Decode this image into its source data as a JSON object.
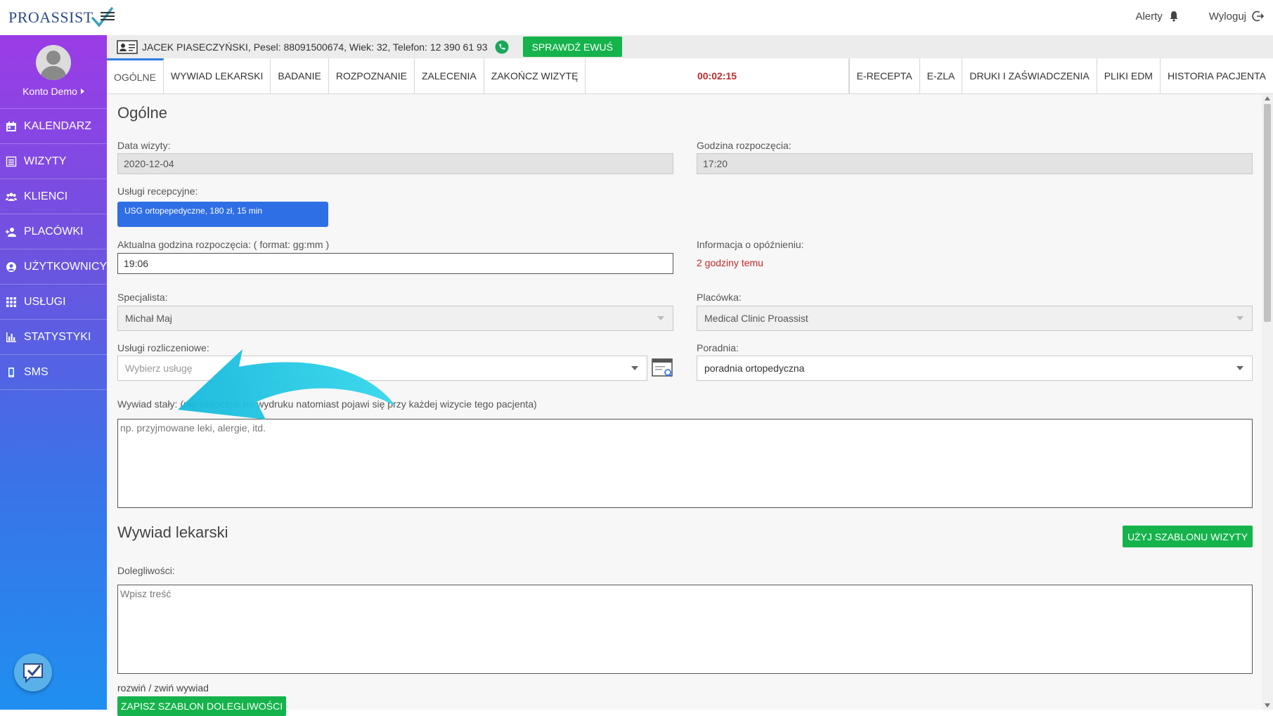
{
  "header": {
    "logo_text": "PROASSIST",
    "alerts_label": "Alerty",
    "logout_label": "Wyloguj"
  },
  "sidebar": {
    "user_name": "Konto Demo",
    "items": [
      {
        "label": "KALENDARZ",
        "icon": "calendar-icon"
      },
      {
        "label": "WIZYTY",
        "icon": "list-icon"
      },
      {
        "label": "KLIENCI",
        "icon": "users-icon"
      },
      {
        "label": "PLACÓWKI",
        "icon": "user-plus-icon"
      },
      {
        "label": "UŻYTKOWNICY",
        "icon": "user-circle-icon"
      },
      {
        "label": "USŁUGI",
        "icon": "grid-icon"
      },
      {
        "label": "STATYSTYKI",
        "icon": "bar-chart-icon"
      },
      {
        "label": "SMS",
        "icon": "mobile-icon"
      }
    ]
  },
  "patient": {
    "info": "JACEK PIASECZYŃSKI, Pesel: 88091500674, Wiek: 32, Telefon: 12 390 61 93",
    "check_button": "SPRAWDŹ EWUŚ"
  },
  "tabs": {
    "left": [
      "OGÓLNE",
      "WYWIAD LEKARSKI",
      "BADANIE",
      "ROZPOZNANIE",
      "ZALECENIA",
      "ZAKOŃCZ WIZYTĘ"
    ],
    "timer": "00:02:15",
    "right": [
      "E-RECEPTA",
      "E-ZLA",
      "DRUKI I ZAŚWIADCZENIA",
      "PLIKI EDM",
      "HISTORIA PACJENTA"
    ],
    "active": "OGÓLNE"
  },
  "general": {
    "title": "Ogólne",
    "visit_date_label": "Data wizyty:",
    "visit_date_value": "2020-12-04",
    "start_time_label": "Godzina rozpoczęcia:",
    "start_time_value": "17:20",
    "reception_services_label": "Usługi recepcyjne:",
    "reception_service_tag": "USG ortopepedyczne, 180 zł, 15 min",
    "actual_start_label": "Aktualna godzina rozpoczęcia: ( format: gg:mm )",
    "actual_start_value": "19:06",
    "delay_label": "Informacja o opóźnieniu:",
    "delay_value": "2 godziny temu",
    "specialist_label": "Specjalista:",
    "specialist_value": "Michał Maj",
    "facility_label": "Placówka:",
    "facility_value": "Medical Clinic Proassist",
    "billing_label": "Usługi rozliczeniowe:",
    "billing_placeholder": "Wybierz usługę",
    "clinic_label": "Poradnia:",
    "clinic_value": "poradnia ortopedyczna",
    "history_label": "Wywiad stały: (nie widoczne na wydruku natomiast pojawi się przy każdej wizycie tego pacjenta)",
    "history_placeholder": "np. przyjmowane leki, alergie, itd."
  },
  "interview": {
    "title": "Wywiad lekarski",
    "template_button": "UŻYJ SZABLONU WIZYTY",
    "complaints_label": "Dolegliwości:",
    "complaints_placeholder": "Wpisz treść",
    "toggle_link": "rozwiń / zwiń wywiad",
    "save_template_button": "ZAPISZ SZABLON DOLEGLIWOŚCI"
  },
  "colors": {
    "accent_green": "#14b34b",
    "tag_blue": "#2f6fe6",
    "timer_red": "#c62828",
    "annotation_arrow": "#1ec8e0"
  }
}
